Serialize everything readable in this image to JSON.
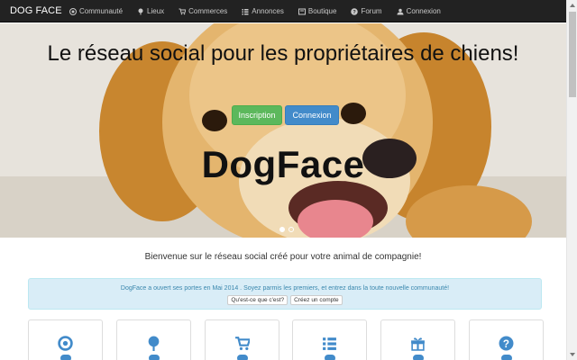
{
  "navbar": {
    "brand": "DOG FACE",
    "items": [
      {
        "label": "Communauté",
        "icon": "target-icon"
      },
      {
        "label": "Lieux",
        "icon": "tree-icon"
      },
      {
        "label": "Commerces",
        "icon": "cart-icon"
      },
      {
        "label": "Annonces",
        "icon": "list-icon"
      },
      {
        "label": "Boutique",
        "icon": "shop-icon"
      },
      {
        "label": "Forum",
        "icon": "question-icon"
      },
      {
        "label": "Connexion",
        "icon": "user-icon"
      }
    ]
  },
  "hero": {
    "title": "Le réseau social pour les propriétaires de chiens!",
    "signup_label": "Inscription",
    "login_label": "Connexion",
    "logo_text": "DogFace"
  },
  "welcome": "Bienvenue sur le réseau social créé pour votre animal de compagnie!",
  "alert": {
    "text": "DogFace a ouvert ses portes en Mai 2014 . Soyez parmis les premiers, et entrez dans la toute nouvelle communauté!",
    "what_label": "Qu'est-ce que c'est?",
    "create_label": "Créez un compte"
  },
  "cards": [
    {
      "icon": "target-icon"
    },
    {
      "icon": "tree-icon"
    },
    {
      "icon": "cart-icon"
    },
    {
      "icon": "list-icon"
    },
    {
      "icon": "gift-icon"
    },
    {
      "icon": "question-icon"
    }
  ],
  "colors": {
    "navbar_bg": "#222222",
    "primary": "#428bca",
    "success": "#5cb85c",
    "alert_bg": "#d9edf7",
    "alert_text": "#3a87ad"
  }
}
